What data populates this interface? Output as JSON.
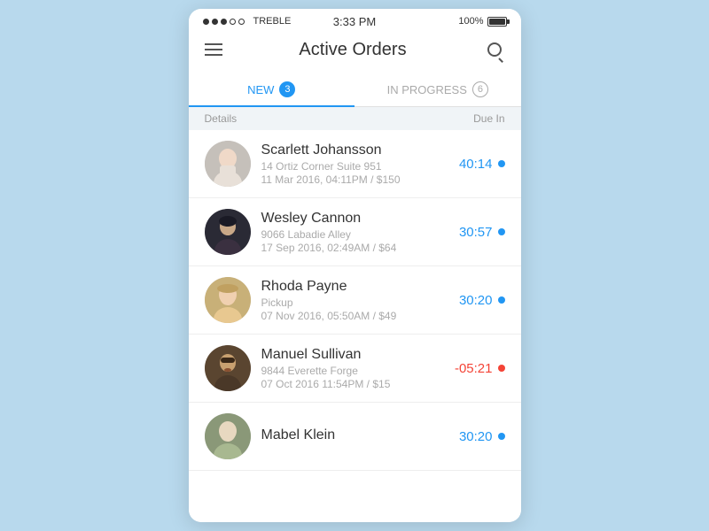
{
  "statusBar": {
    "carrier": "TREBLE",
    "time": "3:33 PM",
    "battery": "100%"
  },
  "header": {
    "title": "Active Orders",
    "menuLabel": "menu",
    "searchLabel": "search"
  },
  "tabs": [
    {
      "label": "NEW",
      "badge": "3",
      "active": true
    },
    {
      "label": "IN PROGRESS",
      "badge": "6",
      "active": false
    }
  ],
  "columnHeaders": {
    "left": "Details",
    "right": "Due In"
  },
  "orders": [
    {
      "name": "Scarlett Johansson",
      "address": "14 Ortiz Corner Suite 951",
      "meta": "11 Mar 2016, 04:11PM  /  $150",
      "time": "40:14",
      "overdue": false,
      "avatarColor": "#b0b8c0"
    },
    {
      "name": "Wesley Cannon",
      "address": "9066 Labadie Alley",
      "meta": "17 Sep 2016, 02:49AM  /  $64",
      "time": "30:57",
      "overdue": false,
      "avatarColor": "#3a3a4a"
    },
    {
      "name": "Rhoda Payne",
      "address": "Pickup",
      "meta": "07 Nov 2016, 05:50AM  /  $49",
      "time": "30:20",
      "overdue": false,
      "avatarColor": "#c8b89a"
    },
    {
      "name": "Manuel Sullivan",
      "address": "9844 Everette Forge",
      "meta": "07 Oct 2016  11:54PM  /  $15",
      "time": "-05:21",
      "overdue": true,
      "avatarColor": "#4a3a2a"
    },
    {
      "name": "Mabel Klein",
      "address": "",
      "meta": "",
      "time": "30:20",
      "overdue": false,
      "avatarColor": "#9aaa8a"
    }
  ]
}
